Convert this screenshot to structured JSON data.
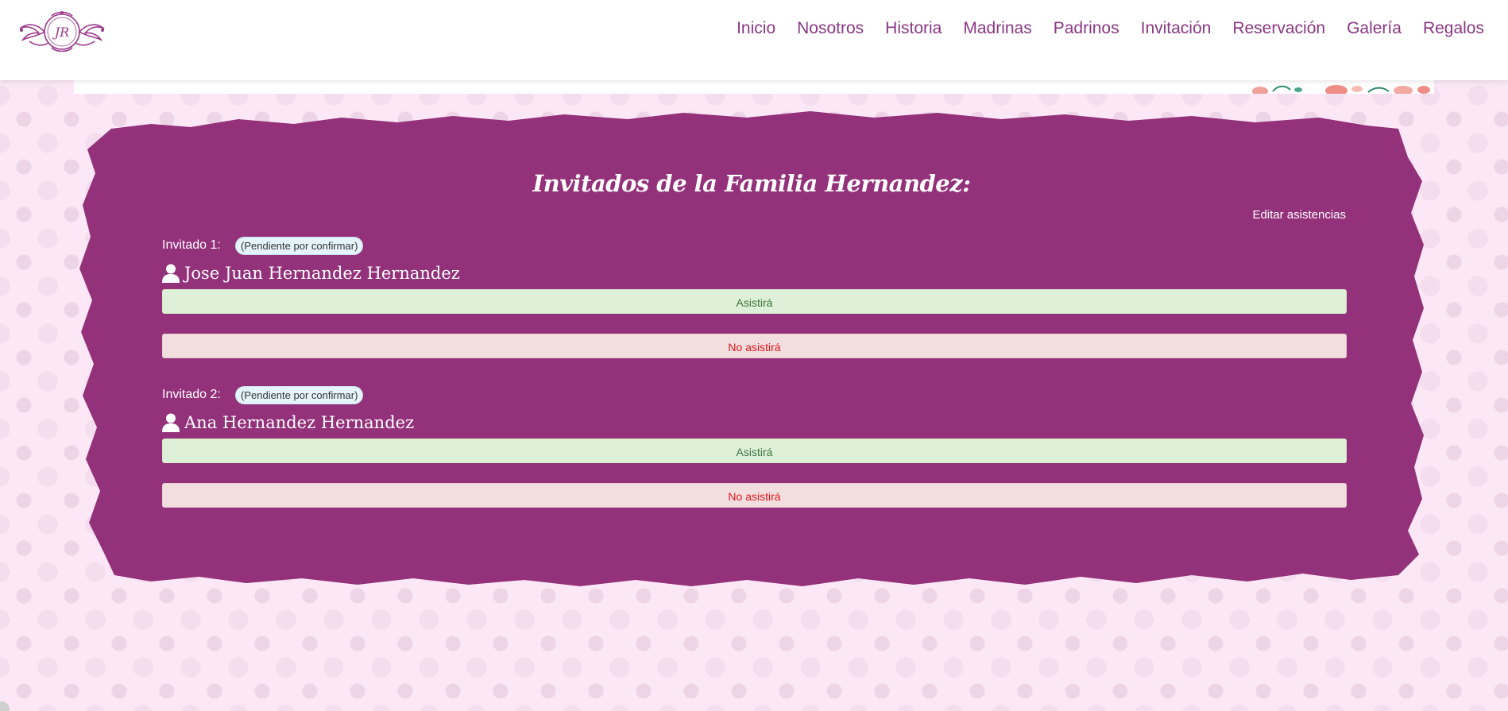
{
  "header": {
    "logo_initials": "JR",
    "nav": [
      {
        "label": "Inicio"
      },
      {
        "label": "Nosotros"
      },
      {
        "label": "Historia"
      },
      {
        "label": "Madrinas"
      },
      {
        "label": "Padrinos"
      },
      {
        "label": "Invitación"
      },
      {
        "label": "Reservación"
      },
      {
        "label": "Galería"
      },
      {
        "label": "Regalos"
      }
    ]
  },
  "panel": {
    "title": "Invitados de la Familia Hernandez:",
    "edit_label": "Editar asistencias",
    "guests": [
      {
        "label": "Invitado 1:",
        "status": "(Pendiente por confirmar)",
        "name": "Jose Juan Hernandez Hernandez",
        "attend_label": "Asistirá",
        "decline_label": "No asistirá"
      },
      {
        "label": "Invitado 2:",
        "status": "(Pendiente por confirmar)",
        "name": "Ana Hernandez Hernandez",
        "attend_label": "Asistirá",
        "decline_label": "No asistirá"
      }
    ]
  },
  "colors": {
    "brand": "#8b3784",
    "panel_bg": "#93317a",
    "page_bg": "#fbe7f5",
    "attend_bg": "#dff0d8",
    "attend_text": "#3c763d",
    "decline_bg": "#f2dede",
    "decline_text": "#e5161d"
  },
  "icons": [
    "monogram-logo",
    "user-icon"
  ]
}
